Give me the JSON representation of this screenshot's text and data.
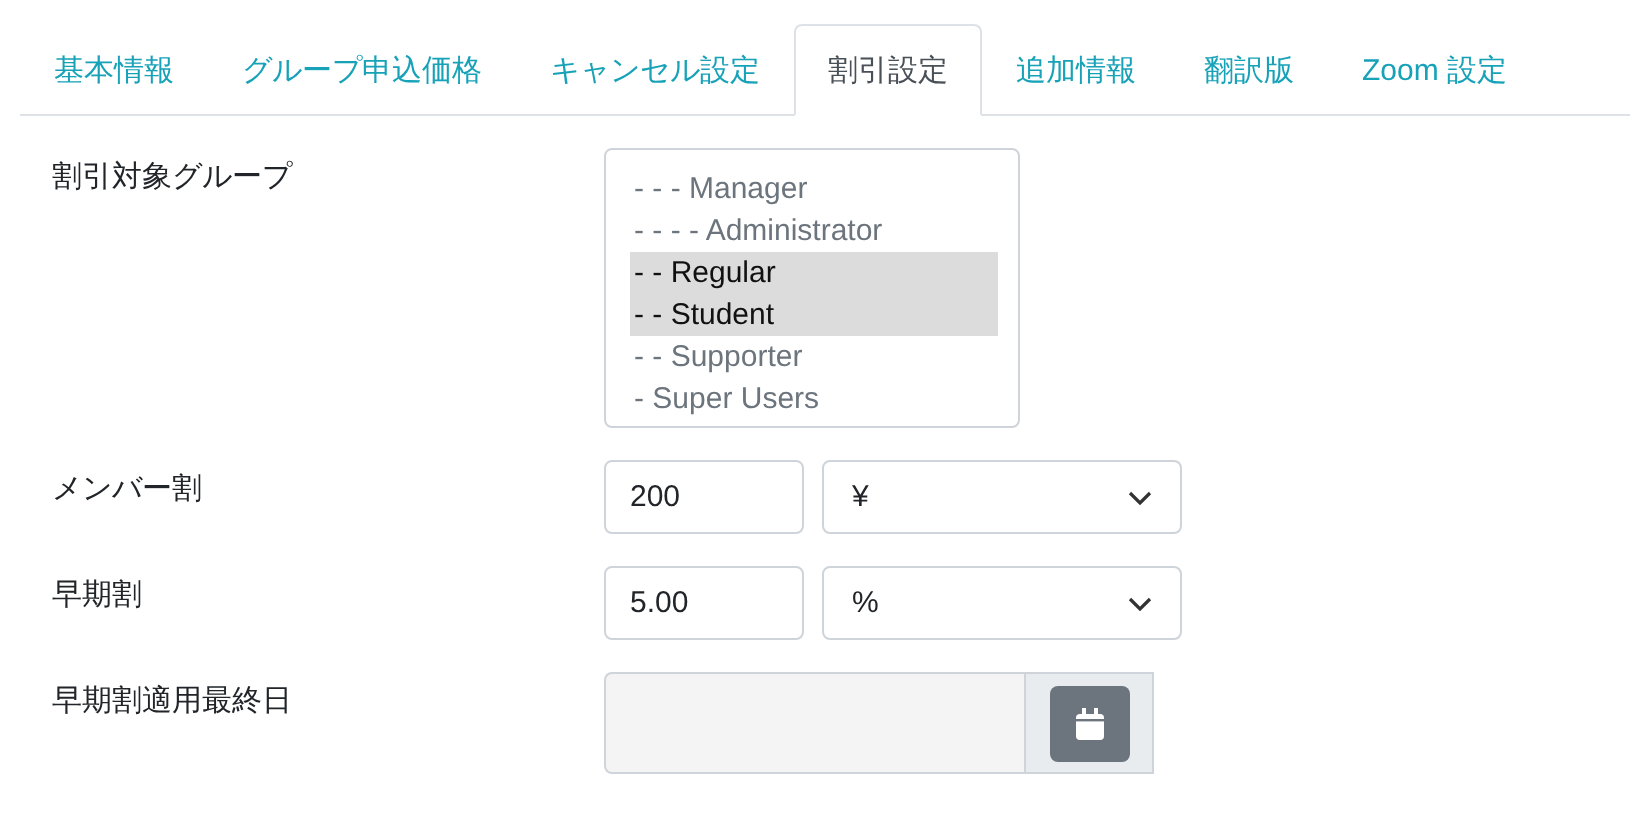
{
  "tabs": [
    {
      "label": "基本情報",
      "selected": false
    },
    {
      "label": "グループ申込価格",
      "selected": false
    },
    {
      "label": "キャンセル設定",
      "selected": false
    },
    {
      "label": "割引設定",
      "selected": true
    },
    {
      "label": "追加情報",
      "selected": false
    },
    {
      "label": "翻訳版",
      "selected": false
    },
    {
      "label": "Zoom 設定",
      "selected": false
    }
  ],
  "fields": [
    {
      "kind": "listbox",
      "label": "割引対象グループ",
      "options": [
        {
          "text": "- - - Manager",
          "selected": false
        },
        {
          "text": "- - - - Administrator",
          "selected": false
        },
        {
          "text": "- - Regular",
          "selected": true
        },
        {
          "text": "- - Student",
          "selected": true
        },
        {
          "text": "- - Supporter",
          "selected": false
        },
        {
          "text": "- Super Users",
          "selected": false
        }
      ]
    },
    {
      "kind": "amount",
      "label": "メンバー割",
      "value": "200",
      "unit": "¥"
    },
    {
      "kind": "amount",
      "label": "早期割",
      "value": "5.00",
      "unit": "%"
    },
    {
      "kind": "date",
      "label": "早期割適用最終日"
    }
  ]
}
